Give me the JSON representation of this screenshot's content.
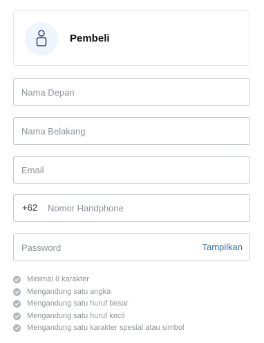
{
  "role": {
    "icon": "user-icon",
    "label": "Pembeli"
  },
  "form": {
    "first_name": {
      "placeholder": "Nama Depan",
      "value": ""
    },
    "last_name": {
      "placeholder": "Nama Belakang",
      "value": ""
    },
    "email": {
      "placeholder": "Email",
      "value": ""
    },
    "phone": {
      "prefix": "+62",
      "placeholder": "Nomor Handphone",
      "value": ""
    },
    "password": {
      "placeholder": "Password",
      "value": "",
      "toggle_label": "Tampilkan"
    }
  },
  "password_rules": [
    {
      "icon": "check-circle-icon",
      "text": "Minimal 8 karakter"
    },
    {
      "icon": "check-circle-icon",
      "text": "Mengandung satu angka"
    },
    {
      "icon": "check-circle-icon",
      "text": "Mengandung satu huruf besar"
    },
    {
      "icon": "check-circle-icon",
      "text": "Mengandung satu huruf kecil"
    },
    {
      "icon": "check-circle-icon",
      "text": "Mengandung satu karakter spesial atau simbol"
    }
  ],
  "colors": {
    "accent_link": "#3a6ea5",
    "avatar_bg": "#eef5fd",
    "rule_icon": "#b3b6ba",
    "border": "#c4c8cc"
  }
}
